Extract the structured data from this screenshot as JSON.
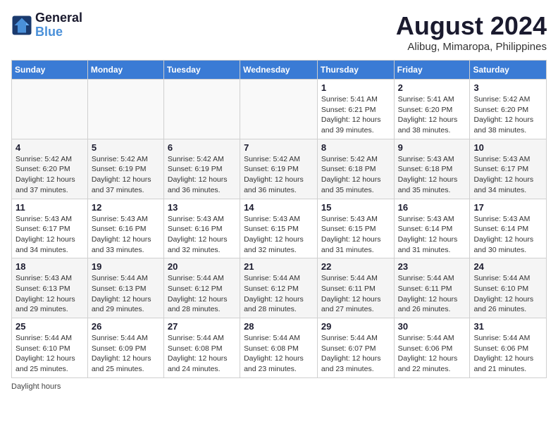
{
  "header": {
    "logo_line1": "General",
    "logo_line2": "Blue",
    "month_year": "August 2024",
    "location": "Alibug, Mimaropa, Philippines"
  },
  "days_of_week": [
    "Sunday",
    "Monday",
    "Tuesday",
    "Wednesday",
    "Thursday",
    "Friday",
    "Saturday"
  ],
  "weeks": [
    [
      {
        "day": "",
        "info": ""
      },
      {
        "day": "",
        "info": ""
      },
      {
        "day": "",
        "info": ""
      },
      {
        "day": "",
        "info": ""
      },
      {
        "day": "1",
        "sunrise": "5:41 AM",
        "sunset": "6:21 PM",
        "daylight": "12 hours and 39 minutes."
      },
      {
        "day": "2",
        "sunrise": "5:41 AM",
        "sunset": "6:20 PM",
        "daylight": "12 hours and 38 minutes."
      },
      {
        "day": "3",
        "sunrise": "5:42 AM",
        "sunset": "6:20 PM",
        "daylight": "12 hours and 38 minutes."
      }
    ],
    [
      {
        "day": "4",
        "sunrise": "5:42 AM",
        "sunset": "6:20 PM",
        "daylight": "12 hours and 37 minutes."
      },
      {
        "day": "5",
        "sunrise": "5:42 AM",
        "sunset": "6:19 PM",
        "daylight": "12 hours and 37 minutes."
      },
      {
        "day": "6",
        "sunrise": "5:42 AM",
        "sunset": "6:19 PM",
        "daylight": "12 hours and 36 minutes."
      },
      {
        "day": "7",
        "sunrise": "5:42 AM",
        "sunset": "6:19 PM",
        "daylight": "12 hours and 36 minutes."
      },
      {
        "day": "8",
        "sunrise": "5:42 AM",
        "sunset": "6:18 PM",
        "daylight": "12 hours and 35 minutes."
      },
      {
        "day": "9",
        "sunrise": "5:43 AM",
        "sunset": "6:18 PM",
        "daylight": "12 hours and 35 minutes."
      },
      {
        "day": "10",
        "sunrise": "5:43 AM",
        "sunset": "6:17 PM",
        "daylight": "12 hours and 34 minutes."
      }
    ],
    [
      {
        "day": "11",
        "sunrise": "5:43 AM",
        "sunset": "6:17 PM",
        "daylight": "12 hours and 34 minutes."
      },
      {
        "day": "12",
        "sunrise": "5:43 AM",
        "sunset": "6:16 PM",
        "daylight": "12 hours and 33 minutes."
      },
      {
        "day": "13",
        "sunrise": "5:43 AM",
        "sunset": "6:16 PM",
        "daylight": "12 hours and 32 minutes."
      },
      {
        "day": "14",
        "sunrise": "5:43 AM",
        "sunset": "6:15 PM",
        "daylight": "12 hours and 32 minutes."
      },
      {
        "day": "15",
        "sunrise": "5:43 AM",
        "sunset": "6:15 PM",
        "daylight": "12 hours and 31 minutes."
      },
      {
        "day": "16",
        "sunrise": "5:43 AM",
        "sunset": "6:14 PM",
        "daylight": "12 hours and 31 minutes."
      },
      {
        "day": "17",
        "sunrise": "5:43 AM",
        "sunset": "6:14 PM",
        "daylight": "12 hours and 30 minutes."
      }
    ],
    [
      {
        "day": "18",
        "sunrise": "5:43 AM",
        "sunset": "6:13 PM",
        "daylight": "12 hours and 29 minutes."
      },
      {
        "day": "19",
        "sunrise": "5:44 AM",
        "sunset": "6:13 PM",
        "daylight": "12 hours and 29 minutes."
      },
      {
        "day": "20",
        "sunrise": "5:44 AM",
        "sunset": "6:12 PM",
        "daylight": "12 hours and 28 minutes."
      },
      {
        "day": "21",
        "sunrise": "5:44 AM",
        "sunset": "6:12 PM",
        "daylight": "12 hours and 28 minutes."
      },
      {
        "day": "22",
        "sunrise": "5:44 AM",
        "sunset": "6:11 PM",
        "daylight": "12 hours and 27 minutes."
      },
      {
        "day": "23",
        "sunrise": "5:44 AM",
        "sunset": "6:11 PM",
        "daylight": "12 hours and 26 minutes."
      },
      {
        "day": "24",
        "sunrise": "5:44 AM",
        "sunset": "6:10 PM",
        "daylight": "12 hours and 26 minutes."
      }
    ],
    [
      {
        "day": "25",
        "sunrise": "5:44 AM",
        "sunset": "6:10 PM",
        "daylight": "12 hours and 25 minutes."
      },
      {
        "day": "26",
        "sunrise": "5:44 AM",
        "sunset": "6:09 PM",
        "daylight": "12 hours and 25 minutes."
      },
      {
        "day": "27",
        "sunrise": "5:44 AM",
        "sunset": "6:08 PM",
        "daylight": "12 hours and 24 minutes."
      },
      {
        "day": "28",
        "sunrise": "5:44 AM",
        "sunset": "6:08 PM",
        "daylight": "12 hours and 23 minutes."
      },
      {
        "day": "29",
        "sunrise": "5:44 AM",
        "sunset": "6:07 PM",
        "daylight": "12 hours and 23 minutes."
      },
      {
        "day": "30",
        "sunrise": "5:44 AM",
        "sunset": "6:06 PM",
        "daylight": "12 hours and 22 minutes."
      },
      {
        "day": "31",
        "sunrise": "5:44 AM",
        "sunset": "6:06 PM",
        "daylight": "12 hours and 21 minutes."
      }
    ]
  ],
  "footer": {
    "note": "Daylight hours"
  }
}
